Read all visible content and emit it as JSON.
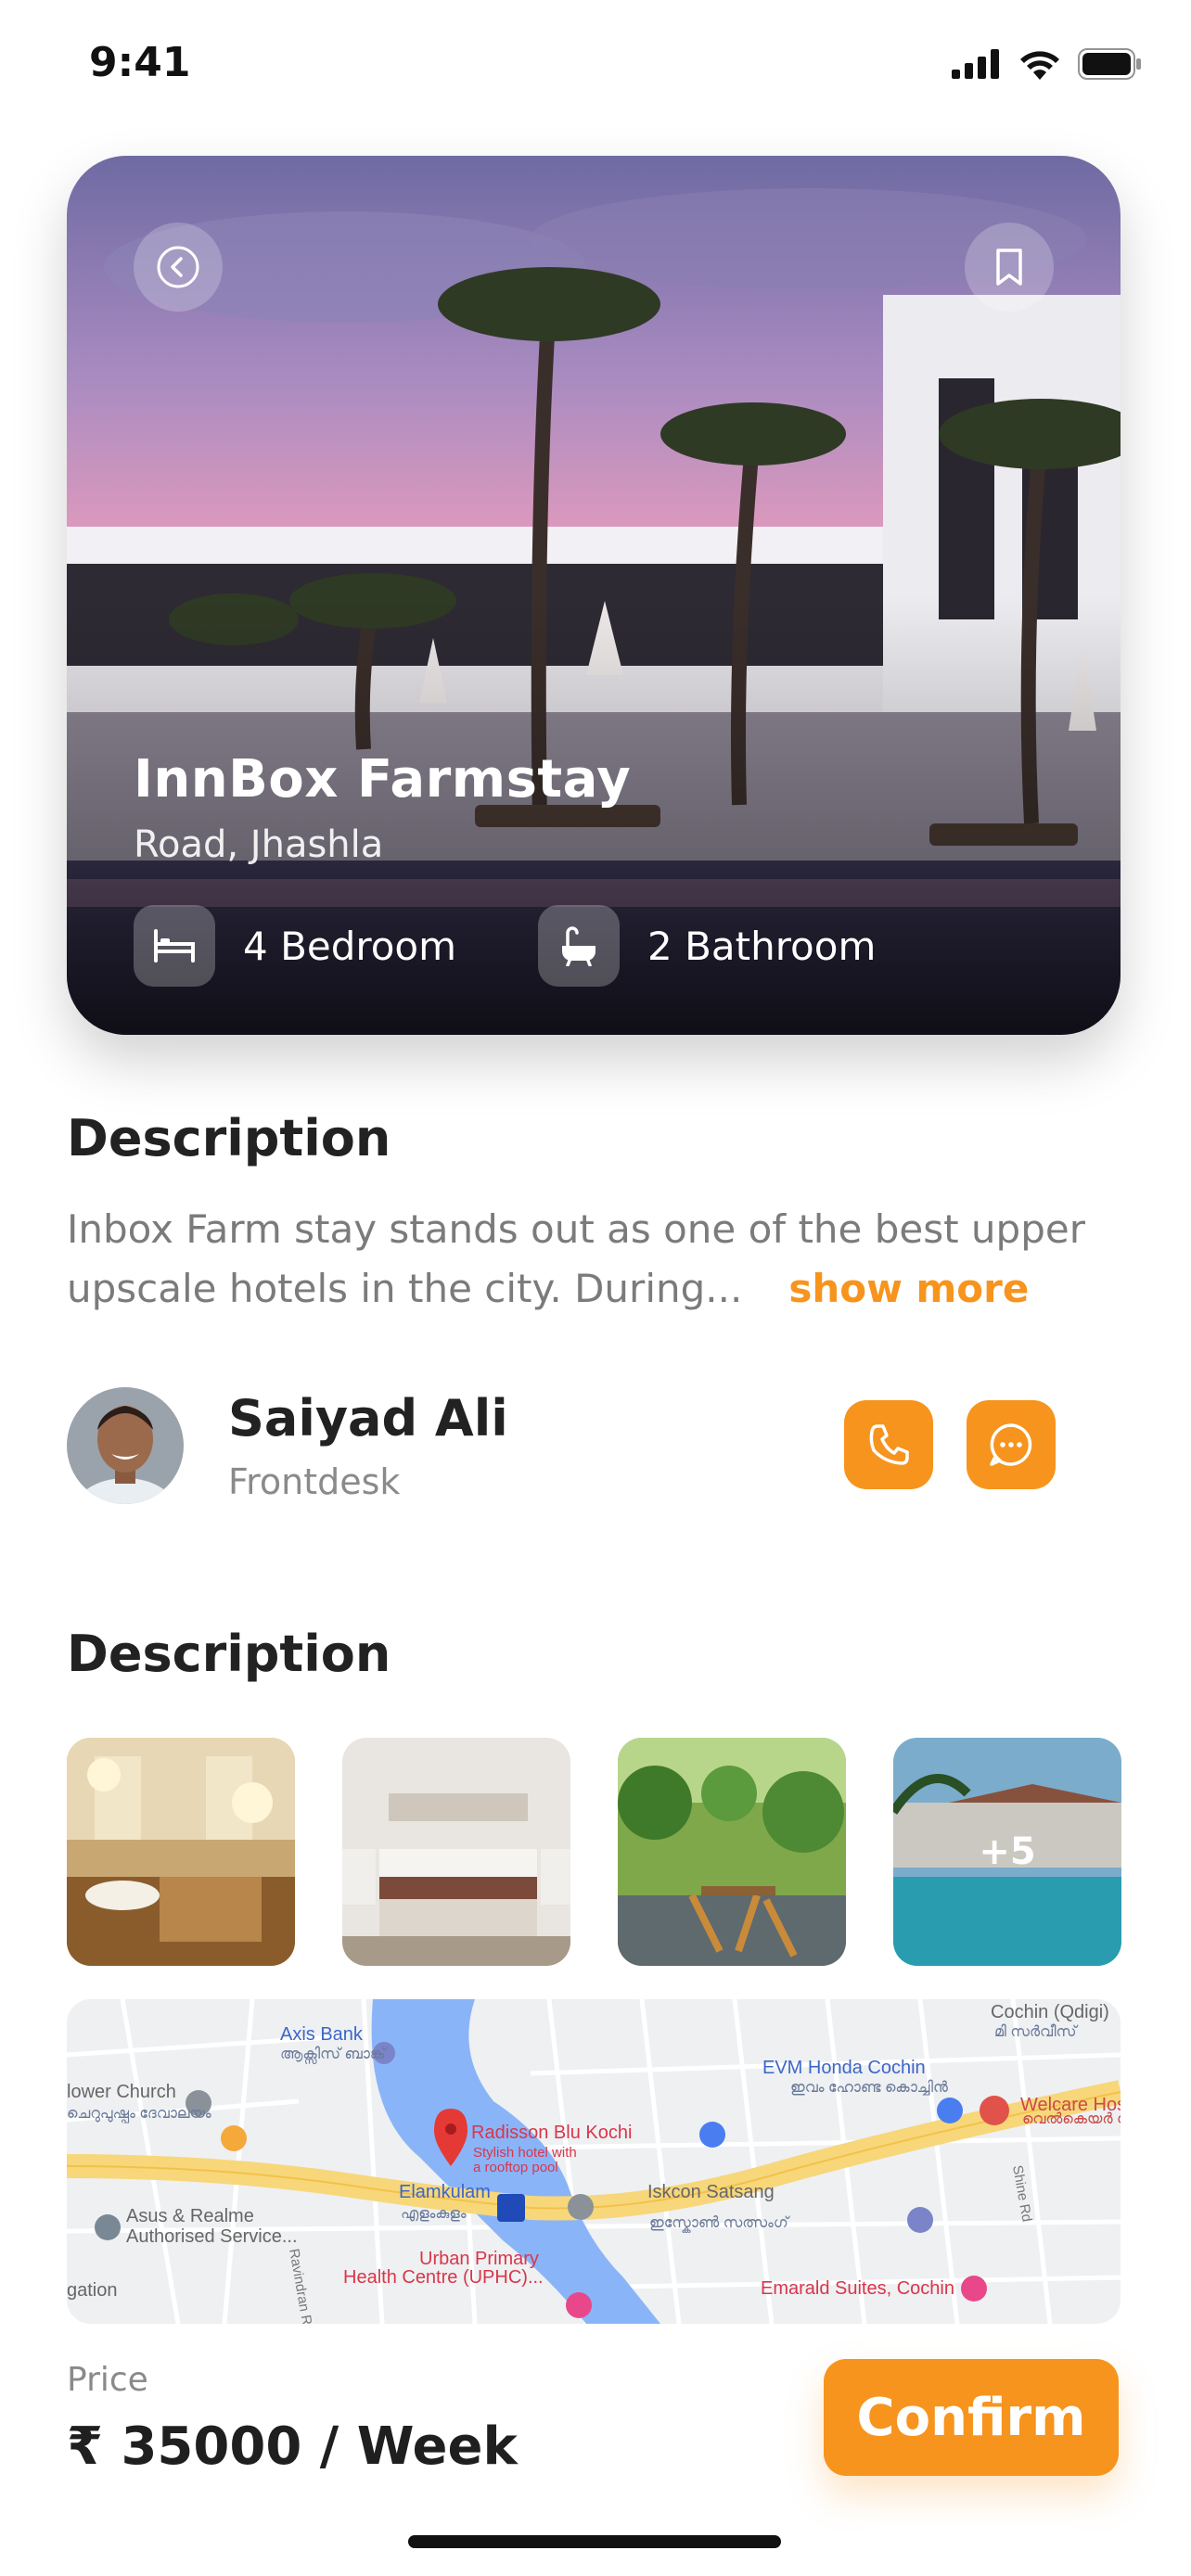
{
  "status_bar": {
    "time": "9:41"
  },
  "hero": {
    "title": "InnBox Farmstay",
    "location": "Road, Jhashla",
    "features": [
      {
        "icon": "bed-icon",
        "label": "4 Bedroom"
      },
      {
        "icon": "bathtub-icon",
        "label": "2 Bathroom"
      }
    ]
  },
  "description": {
    "heading": "Description",
    "text_line1": "Inbox Farm stay stands out as one of the best upper",
    "text_line2": "upscale hotels in the city. During...",
    "show_more": "show more"
  },
  "host": {
    "name": "Saiyad Ali",
    "role": "Frontdesk"
  },
  "gallery": {
    "heading": "Description",
    "more_count": "+5"
  },
  "map": {
    "labels": {
      "cochin": "Cochin (Qdigi)",
      "cochin_ml": "മി സർവീസ്",
      "axis": "Axis Bank",
      "axis_ml": "ആക്സിസ് ബാങ്ക്",
      "evm": "EVM Honda Cochin",
      "evm_ml": "ഇവം ഹോണ്ട കൊച്ചിൻ",
      "welcare": "Welcare Hos",
      "welcare_ml": "വെൽകെയർ ഹോസ്പിറ്റൽ",
      "church": "lower Church",
      "church_ml": "ചെറുപുഷ്പം ദേവാലയം",
      "radisson": "Radisson Blu Kochi",
      "radisson_sub1": "Stylish hotel with",
      "radisson_sub2": "a rooftop pool",
      "elamkulam": "Elamkulam",
      "elamkulam_ml": "എളംകുളം",
      "iskcon": "Iskcon Satsang",
      "iskcon_ml": "ഇസ്കോൺ സത്സംഗ്",
      "asus": "Asus & Realme",
      "asus_sub": "Authorised Service...",
      "urban": "Urban Primary",
      "urban_sub": "Health Centre (UPHC)...",
      "emerald": "Emarald Suites, Cochin",
      "gation": "gation",
      "shine": "Shine Rd",
      "ravindran": "Ravindran R"
    }
  },
  "footer": {
    "price_label": "Price",
    "price_value": "₹ 35000 / Week",
    "confirm_label": "Confirm"
  },
  "colors": {
    "accent": "#F7941D"
  }
}
